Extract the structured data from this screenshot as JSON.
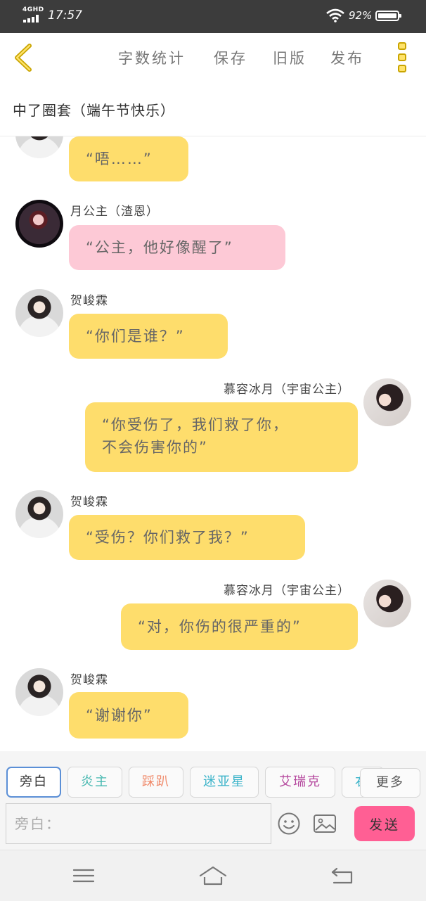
{
  "status_bar": {
    "network": "4GHD",
    "time": "17:57",
    "battery": "92%",
    "icons": [
      "signal-icon",
      "wifi-icon",
      "battery-icon"
    ]
  },
  "toolbar": {
    "back_icon": "chevron-left-icon",
    "word_count": "字数统计",
    "save": "保存",
    "old_version": "旧版",
    "publish": "发布",
    "menu_icon": "more-vertical-icon"
  },
  "story": {
    "title": "中了圈套（端午节快乐）"
  },
  "messages": [
    {
      "side": "left",
      "avatar": "boy",
      "sender": "",
      "text": "“唔……”"
    },
    {
      "side": "left",
      "avatar": "dark",
      "sender": "月公主（渣恩）",
      "text": "“公主，他好像醒了”",
      "color": "pink"
    },
    {
      "side": "left",
      "avatar": "boy",
      "sender": "贺峻霖",
      "text": "“你们是谁？”"
    },
    {
      "side": "right",
      "avatar": "girl",
      "sender": "慕容冰月（宇宙公主）",
      "text_lines": [
        "“你受伤了，我们救了你，",
        "不会伤害你的”"
      ]
    },
    {
      "side": "left",
      "avatar": "boy",
      "sender": "贺峻霖",
      "text": "“受伤？你们救了我？”"
    },
    {
      "side": "right",
      "avatar": "girl",
      "sender": "慕容冰月（宇宙公主）",
      "text": "“对，你伤的很严重的”"
    },
    {
      "side": "left",
      "avatar": "boy",
      "sender": "贺峻霖",
      "text": "“谢谢你”"
    }
  ],
  "composer": {
    "roles": [
      {
        "label": "旁白",
        "color": "#555555",
        "active": true
      },
      {
        "label": "炎主",
        "color": "#46b8b0"
      },
      {
        "label": "踩趴",
        "color": "#f08a6a"
      },
      {
        "label": "迷亚星",
        "color": "#3ab3c9"
      },
      {
        "label": "艾瑞克",
        "color": "#b5489e"
      },
      {
        "label": "右",
        "color": "#3ab3c9"
      }
    ],
    "more_label": "更多",
    "input_placeholder": "旁白：",
    "send_label": "发送",
    "emoji_icon": "smiley-icon",
    "image_icon": "image-icon"
  },
  "navbar": {
    "icons": [
      "menu-icon",
      "home-icon",
      "back-icon"
    ]
  },
  "colors": {
    "bubble_yellow": "#fedd6c",
    "bubble_pink": "#fdc9d6",
    "send_button": "#ff5f94",
    "accent_yellow": "#c9a400"
  }
}
